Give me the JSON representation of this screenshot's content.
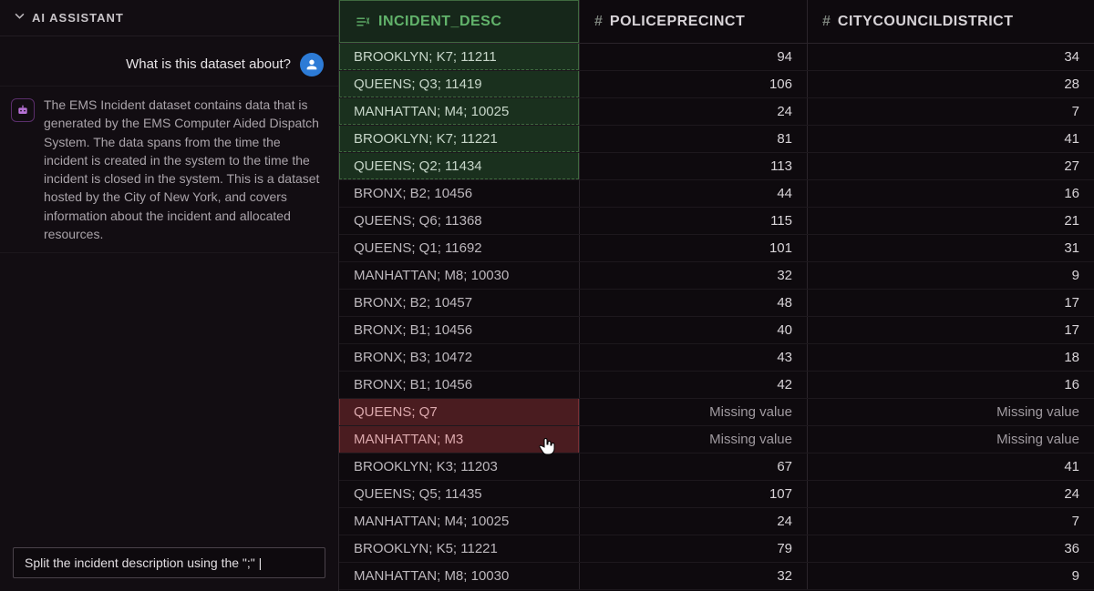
{
  "sidebar": {
    "title": "AI ASSISTANT",
    "user_message": "What is this dataset about?",
    "assistant_message": "The EMS Incident dataset contains data that is generated by the EMS Computer Aided Dispatch System. The data spans from the time the incident is created in the system to the time the incident is closed in the system. This is a dataset hosted by the City of New York, and covers information about the incident and allocated resources.",
    "input_value": "Split the incident description using the \";\" |"
  },
  "table": {
    "columns": [
      {
        "label": "INCIDENT_DESC",
        "type": "text"
      },
      {
        "label": "POLICEPRECINCT",
        "type": "number"
      },
      {
        "label": "CITYCOUNCILDISTRICT",
        "type": "number"
      }
    ],
    "rows": [
      {
        "desc": "BROOKLYN; K7; 11211",
        "p": "94",
        "c": "34",
        "hl": "green"
      },
      {
        "desc": "QUEENS; Q3; 11419",
        "p": "106",
        "c": "28",
        "hl": "green"
      },
      {
        "desc": "MANHATTAN; M4; 10025",
        "p": "24",
        "c": "7",
        "hl": "green"
      },
      {
        "desc": "BROOKLYN; K7; 11221",
        "p": "81",
        "c": "41",
        "hl": "green"
      },
      {
        "desc": "QUEENS; Q2; 11434",
        "p": "113",
        "c": "27",
        "hl": "green"
      },
      {
        "desc": "BRONX; B2; 10456",
        "p": "44",
        "c": "16",
        "hl": ""
      },
      {
        "desc": "QUEENS; Q6; 11368",
        "p": "115",
        "c": "21",
        "hl": ""
      },
      {
        "desc": "QUEENS; Q1; 11692",
        "p": "101",
        "c": "31",
        "hl": ""
      },
      {
        "desc": "MANHATTAN; M8; 10030",
        "p": "32",
        "c": "9",
        "hl": ""
      },
      {
        "desc": "BRONX; B2; 10457",
        "p": "48",
        "c": "17",
        "hl": ""
      },
      {
        "desc": "BRONX; B1; 10456",
        "p": "40",
        "c": "17",
        "hl": ""
      },
      {
        "desc": "BRONX; B3; 10472",
        "p": "43",
        "c": "18",
        "hl": ""
      },
      {
        "desc": "BRONX; B1; 10456",
        "p": "42",
        "c": "16",
        "hl": ""
      },
      {
        "desc": "QUEENS; Q7",
        "p": "Missing value",
        "c": "Missing value",
        "hl": "red"
      },
      {
        "desc": "MANHATTAN; M3",
        "p": "Missing value",
        "c": "Missing value",
        "hl": "red"
      },
      {
        "desc": "BROOKLYN; K3; 11203",
        "p": "67",
        "c": "41",
        "hl": ""
      },
      {
        "desc": "QUEENS; Q5; 11435",
        "p": "107",
        "c": "24",
        "hl": ""
      },
      {
        "desc": "MANHATTAN; M4; 10025",
        "p": "24",
        "c": "7",
        "hl": ""
      },
      {
        "desc": "BROOKLYN; K5; 11221",
        "p": "79",
        "c": "36",
        "hl": ""
      },
      {
        "desc": "MANHATTAN; M8; 10030",
        "p": "32",
        "c": "9",
        "hl": ""
      }
    ]
  }
}
